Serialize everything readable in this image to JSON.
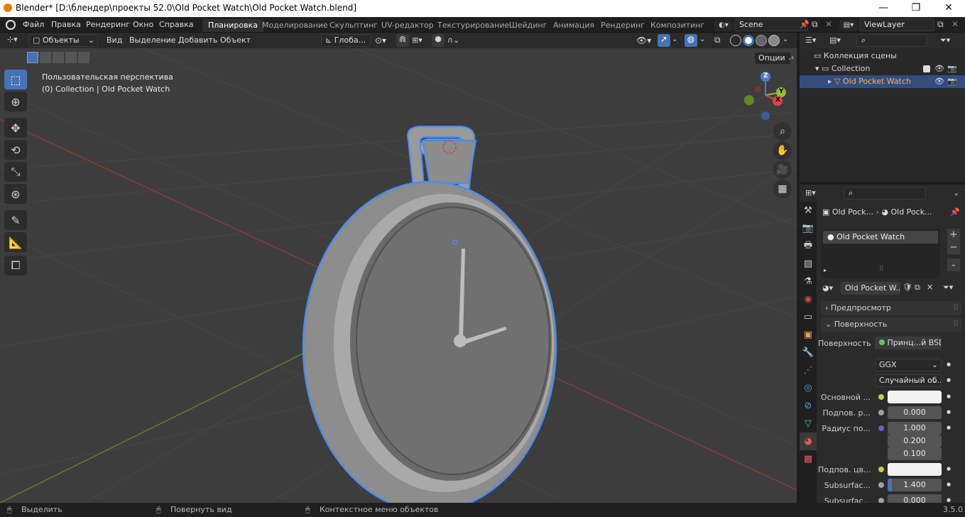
{
  "window": {
    "title": "Blender* [D:\\блендер\\проекты 52.0\\Old Pocket Watch\\Old Pocket Watch.blend]",
    "minimize": "—",
    "maximize": "❐",
    "close": "✕"
  },
  "menu": [
    "Файл",
    "Правка",
    "Рендеринг",
    "Окно",
    "Справка"
  ],
  "workspaces": [
    "Планировка",
    "Моделирование",
    "Скульптинг",
    "UV-редактор",
    "Текстурирование",
    "Шейдинг",
    "Анимация",
    "Рендеринг",
    "Композитинг"
  ],
  "scene": {
    "name": "Scene",
    "viewlayer": "ViewLayer"
  },
  "viewport_header": {
    "mode": "Объекты",
    "menus": [
      "Вид",
      "Выделение",
      "Добавить",
      "Объект"
    ],
    "transform": "Глоба...",
    "options": "Опции"
  },
  "viewport": {
    "perspective": "Пользовательская перспектива",
    "collection_info": "(0) Collection | Old Pocket Watch",
    "gizmo": {
      "x": "X",
      "y": "Y",
      "z": "Z"
    }
  },
  "outliner": {
    "items": [
      {
        "label": "Коллекция сцены"
      },
      {
        "label": "Collection"
      },
      {
        "label": "Old Pocket Watch",
        "selected": true
      }
    ]
  },
  "properties": {
    "breadcrumb": [
      "Old Pock...",
      "Old Pock..."
    ],
    "material_slot": "Old Pocket Watch",
    "material_name": "Old Pocket W...",
    "panels": {
      "preview": "Предпросмотр",
      "surface": "Поверхность"
    },
    "surface": {
      "label": "Поверхность",
      "shader": "Принц...й BSDF",
      "distribution": "GGX",
      "subsurface_method": "Случайный об...",
      "rows": [
        {
          "label": "Основной ...",
          "type": "color",
          "value": ""
        },
        {
          "label": "Подпов. р...",
          "type": "number",
          "value": "0.000"
        },
        {
          "label": "Радиус по...",
          "type": "number",
          "value": "1.000"
        },
        {
          "label": "",
          "type": "number",
          "value": "0.200"
        },
        {
          "label": "",
          "type": "number",
          "value": "0.100"
        },
        {
          "label": "Подпов. цв...",
          "type": "color",
          "value": ""
        },
        {
          "label": "Subsurfac...",
          "type": "number",
          "value": "1.400"
        },
        {
          "label": "Subsurfac...",
          "type": "number",
          "value": "0.000"
        }
      ]
    }
  },
  "statusbar": {
    "select": "Выделить",
    "rotate": "Повернуть вид",
    "context": "Контекстное меню объектов",
    "version": "3.5.0"
  },
  "colors": {
    "accent": "#4772b3",
    "selection_outline": "#4a8cf0",
    "viewport_bg": "#3d3d3d"
  }
}
